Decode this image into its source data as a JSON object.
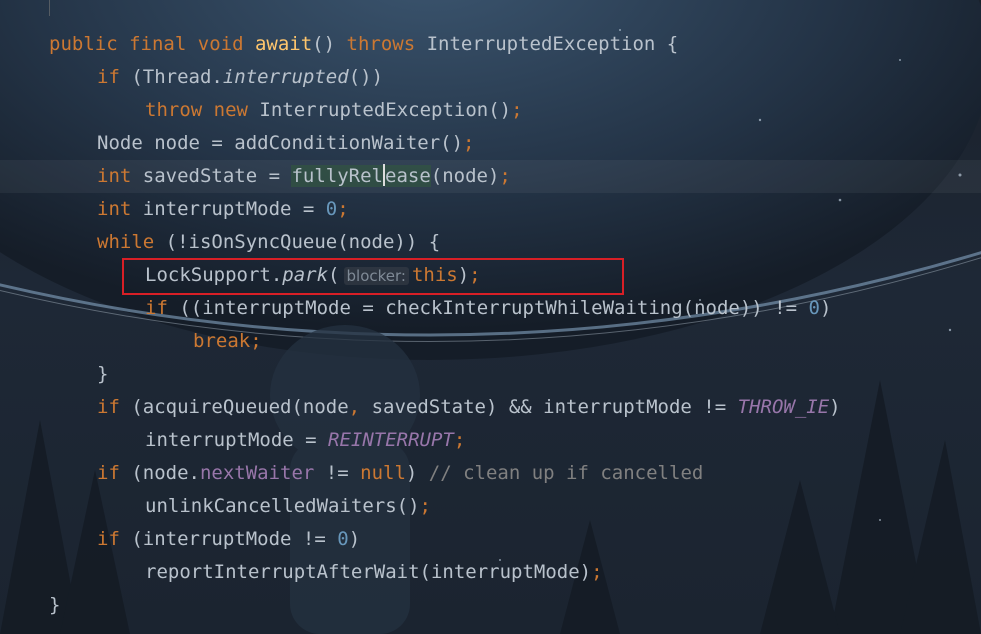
{
  "editor": {
    "language": "Java",
    "lines": [
      {
        "indent": 0,
        "tokens": [
          [
            "public",
            "kw"
          ],
          [
            " ",
            ""
          ],
          [
            "final",
            "kw"
          ],
          [
            " ",
            ""
          ],
          [
            "void",
            "kw"
          ],
          [
            " ",
            ""
          ],
          [
            "await",
            "fn"
          ],
          [
            "() ",
            ""
          ],
          [
            "throws",
            "kw"
          ],
          [
            " InterruptedException {",
            ""
          ]
        ]
      },
      {
        "indent": 1,
        "tokens": [
          [
            "if",
            "kw"
          ],
          [
            " (Thread.",
            ""
          ],
          [
            "interrupted",
            "it"
          ],
          [
            "())",
            ""
          ]
        ]
      },
      {
        "indent": 2,
        "tokens": [
          [
            "throw",
            "kw"
          ],
          [
            " ",
            ""
          ],
          [
            "new",
            "kw"
          ],
          [
            " InterruptedException()",
            ""
          ],
          [
            ";",
            "kw"
          ]
        ]
      },
      {
        "indent": 1,
        "tokens": [
          [
            "Node node = addConditionWaiter()",
            ""
          ],
          [
            ";",
            "kw"
          ]
        ]
      },
      {
        "indent": 1,
        "current": true,
        "tokens": [
          [
            "int",
            "kw"
          ],
          [
            " savedState = ",
            ""
          ],
          [
            "fullyRel",
            "hl-usage"
          ],
          [
            "",
            "caret"
          ],
          [
            "ease",
            "hl-usage"
          ],
          [
            "(node)",
            ""
          ],
          [
            ";",
            "kw"
          ]
        ]
      },
      {
        "indent": 1,
        "tokens": [
          [
            "int",
            "kw"
          ],
          [
            " interruptMode = ",
            ""
          ],
          [
            "0",
            "num"
          ],
          [
            ";",
            "kw"
          ]
        ]
      },
      {
        "indent": 1,
        "tokens": [
          [
            "while",
            "kw"
          ],
          [
            " (!isOnSyncQueue(node)) {",
            ""
          ]
        ]
      },
      {
        "indent": 2,
        "tokens": [
          [
            "LockSupport.",
            ""
          ],
          [
            "park",
            "it"
          ],
          [
            "(",
            ""
          ],
          [
            "blocker:",
            "hint"
          ],
          [
            "this",
            "kw"
          ],
          [
            ")",
            ""
          ],
          [
            ";",
            "kw"
          ]
        ]
      },
      {
        "indent": 2,
        "tokens": [
          [
            "if",
            "kw"
          ],
          [
            " ((interruptMode = checkInterruptWhileWaiting(node)) != ",
            ""
          ],
          [
            "0",
            "num"
          ],
          [
            ")",
            ""
          ]
        ]
      },
      {
        "indent": 3,
        "tokens": [
          [
            "break",
            "kw"
          ],
          [
            ";",
            "kw"
          ]
        ]
      },
      {
        "indent": 1,
        "tokens": [
          [
            "}",
            ""
          ]
        ]
      },
      {
        "indent": 1,
        "tokens": [
          [
            "if",
            "kw"
          ],
          [
            " (acquireQueued(node",
            ""
          ],
          [
            ",",
            "kw"
          ],
          [
            " savedState) && interruptMode != ",
            ""
          ],
          [
            "THROW_IE",
            "const"
          ],
          [
            ")",
            ""
          ]
        ]
      },
      {
        "indent": 2,
        "tokens": [
          [
            "interruptMode = ",
            ""
          ],
          [
            "REINTERRUPT",
            "const"
          ],
          [
            ";",
            "kw"
          ]
        ]
      },
      {
        "indent": 1,
        "tokens": [
          [
            "if",
            "kw"
          ],
          [
            " (node.",
            ""
          ],
          [
            "nextWaiter",
            "fld"
          ],
          [
            " != ",
            ""
          ],
          [
            "null",
            "kw"
          ],
          [
            ") ",
            ""
          ],
          [
            "// clean up if cancelled",
            "cmt"
          ]
        ]
      },
      {
        "indent": 2,
        "tokens": [
          [
            "unlinkCancelledWaiters()",
            ""
          ],
          [
            ";",
            "kw"
          ]
        ]
      },
      {
        "indent": 1,
        "tokens": [
          [
            "if",
            "kw"
          ],
          [
            " (interruptMode != ",
            ""
          ],
          [
            "0",
            "num"
          ],
          [
            ")",
            ""
          ]
        ]
      },
      {
        "indent": 2,
        "tokens": [
          [
            "reportInterruptAfterWait(interruptMode)",
            ""
          ],
          [
            ";",
            "kw"
          ]
        ]
      },
      {
        "indent": 0,
        "tokens": [
          [
            "}",
            ""
          ]
        ]
      }
    ],
    "highlighted_line": 7
  }
}
